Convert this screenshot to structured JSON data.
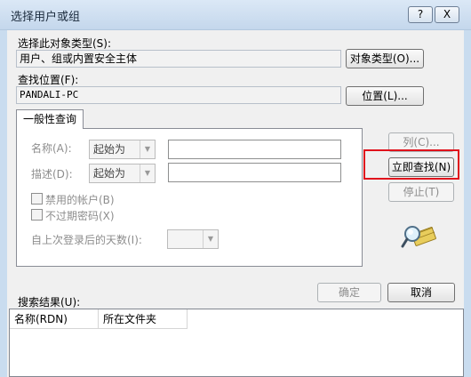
{
  "window": {
    "title": "选择用户或组",
    "help_label": "?",
    "close_label": "X"
  },
  "object_type": {
    "label": "选择此对象类型(S):",
    "value": "用户、组或内置安全主体",
    "button": "对象类型(O)..."
  },
  "location": {
    "label": "查找位置(F):",
    "value": "PANDALI-PC",
    "button": "位置(L)..."
  },
  "tab": {
    "label": "一般性查询"
  },
  "query": {
    "name_label": "名称(A):",
    "name_combo": "起始为",
    "desc_label": "描述(D):",
    "desc_combo": "起始为",
    "disabled_accounts": "禁用的帐户(B)",
    "no_expire_pw": "不过期密码(X)",
    "days_label": "自上次登录后的天数(I):"
  },
  "side_buttons": {
    "columns": "列(C)...",
    "find_now": "立即查找(N)",
    "stop": "停止(T)"
  },
  "dialog_buttons": {
    "ok": "确定",
    "cancel": "取消"
  },
  "results": {
    "label": "搜索结果(U):",
    "columns": [
      "名称(RDN)",
      "所在文件夹"
    ]
  },
  "colors": {
    "highlight": "#e0121c"
  },
  "icons": {
    "search_icon": "magnifier-icon"
  }
}
